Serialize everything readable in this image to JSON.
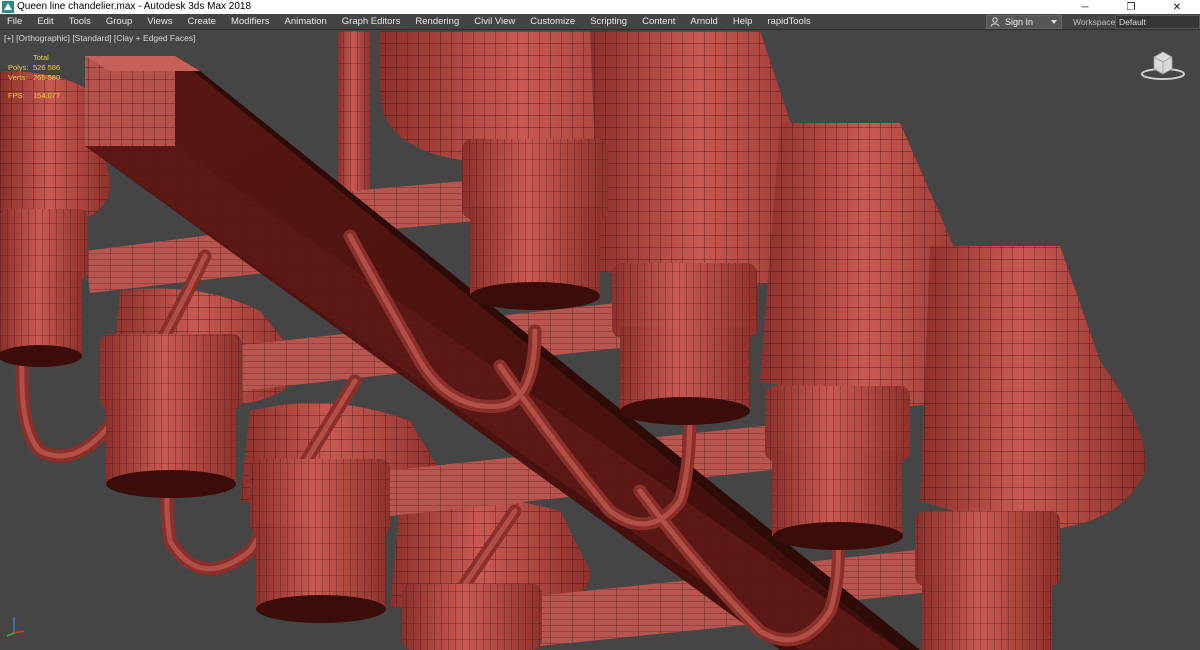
{
  "window": {
    "title": "Queen line chandelier.max - Autodesk 3ds Max 2018",
    "app_icon": "3dsmax-logo-icon",
    "controls": {
      "minimize": "─",
      "restore": "❐",
      "close": "✕"
    }
  },
  "menu": {
    "items": [
      "File",
      "Edit",
      "Tools",
      "Group",
      "Views",
      "Create",
      "Modifiers",
      "Animation",
      "Graph Editors",
      "Rendering",
      "Civil View",
      "Customize",
      "Scripting",
      "Content",
      "Arnold",
      "Help",
      "rapidTools"
    ],
    "signin_label": "Sign In",
    "signin_icon": "user-icon",
    "workspaces_label": "Workspaces:",
    "workspace_value": "Default"
  },
  "viewport": {
    "label_parts": [
      "[+]",
      "[Orthographic]",
      "[Standard]",
      "[Clay + Edged Faces]"
    ],
    "stats": {
      "total_label": "Total",
      "polys_label": "Polys:",
      "polys_value": "526 586",
      "verts_label": "Verts:",
      "verts_value": "265 580",
      "fps_label": "FPS:",
      "fps_value": "154.077"
    },
    "colors": {
      "background": "#454545",
      "clay": "#b9504a",
      "wire": "#3a120f",
      "stats_text": "#e9d046"
    },
    "viewcube_icon": "viewcube-icon",
    "axis_icon": "axis-tripod-icon"
  }
}
